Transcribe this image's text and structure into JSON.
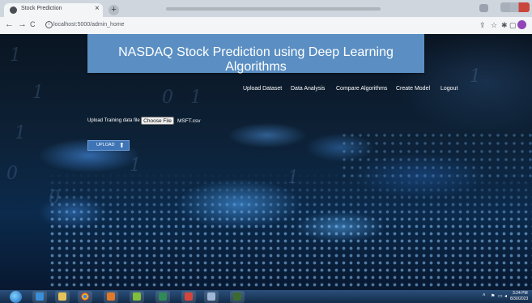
{
  "browser": {
    "tab_title": "Stock Prediction",
    "close_glyph": "×",
    "new_tab_glyph": "+",
    "url": "localhost:5000/admin_home",
    "back_glyph": "←",
    "forward_glyph": "→",
    "reload_glyph": "C"
  },
  "page": {
    "header_title": "NASDAQ Stock Prediction using Deep Learning Algorithms",
    "menu": [
      "Upload Dataset",
      "Data Analysis",
      "Compare Algorithms",
      "Create Model",
      "Logout"
    ],
    "upload_label": "Upload Training data file",
    "choose_file_label": "Choose File",
    "file_name": "MSFT.csv",
    "upload_button": "UPLOAD",
    "upload_arrow": "⬆"
  },
  "taskbar": {
    "time": "3:24 PM",
    "date": "8/30/2023",
    "apps": [
      "internet-explorer-icon",
      "file-explorer-icon",
      "chrome-icon",
      "media-player-icon",
      "app-icon-green",
      "excel-icon",
      "app-icon-red",
      "notepad-icon",
      "app-icon-dark"
    ]
  }
}
